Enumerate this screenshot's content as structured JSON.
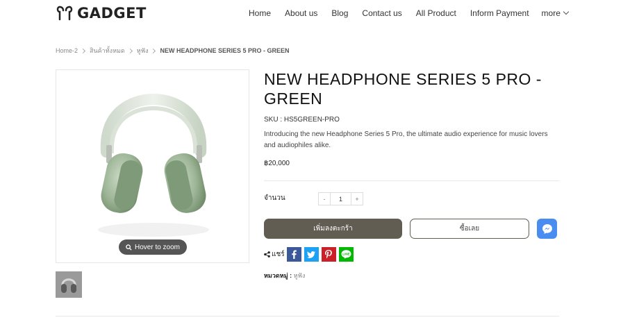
{
  "brand": {
    "name": "GADGET"
  },
  "nav": {
    "items": [
      "Home",
      "About us",
      "Blog",
      "Contact us",
      "All Product",
      "Inform Payment"
    ],
    "more_label": "more"
  },
  "breadcrumb": {
    "items": [
      "Home-2",
      "สินค้าทั้งหมด",
      "หูฟัง"
    ],
    "current": "NEW HEADPHONE SERIES 5 PRO - GREEN"
  },
  "gallery": {
    "zoom_label": "Hover to zoom"
  },
  "product": {
    "title": "NEW HEADPHONE SERIES 5 PRO - GREEN",
    "sku": "SKU : HS5GREEN-PRO",
    "description": "Introducing the new Headphone Series 5 Pro, the ultimate audio experience for music lovers and audiophiles alike.",
    "price": "฿20,000",
    "quantity_label": "จำนวน",
    "quantity": "1",
    "qty_minus": "-",
    "qty_plus": "+",
    "add_to_cart_label": "เพิ่มลงตะกร้า",
    "buy_now_label": "ซื้อเลย",
    "share_label": "แชร์",
    "category_label": "หมวดหมู่ :",
    "category_value": "หูฟัง"
  },
  "icons": {
    "facebook": "facebook-icon",
    "twitter": "twitter-icon",
    "pinterest": "pinterest-icon",
    "line": "line-icon",
    "messenger": "messenger-icon"
  },
  "colors": {
    "primary_button": "#615d53",
    "messenger": "#4a8df0",
    "facebook": "#3b5998",
    "twitter": "#1da1f2",
    "pinterest": "#cb2027",
    "line": "#00b900"
  }
}
